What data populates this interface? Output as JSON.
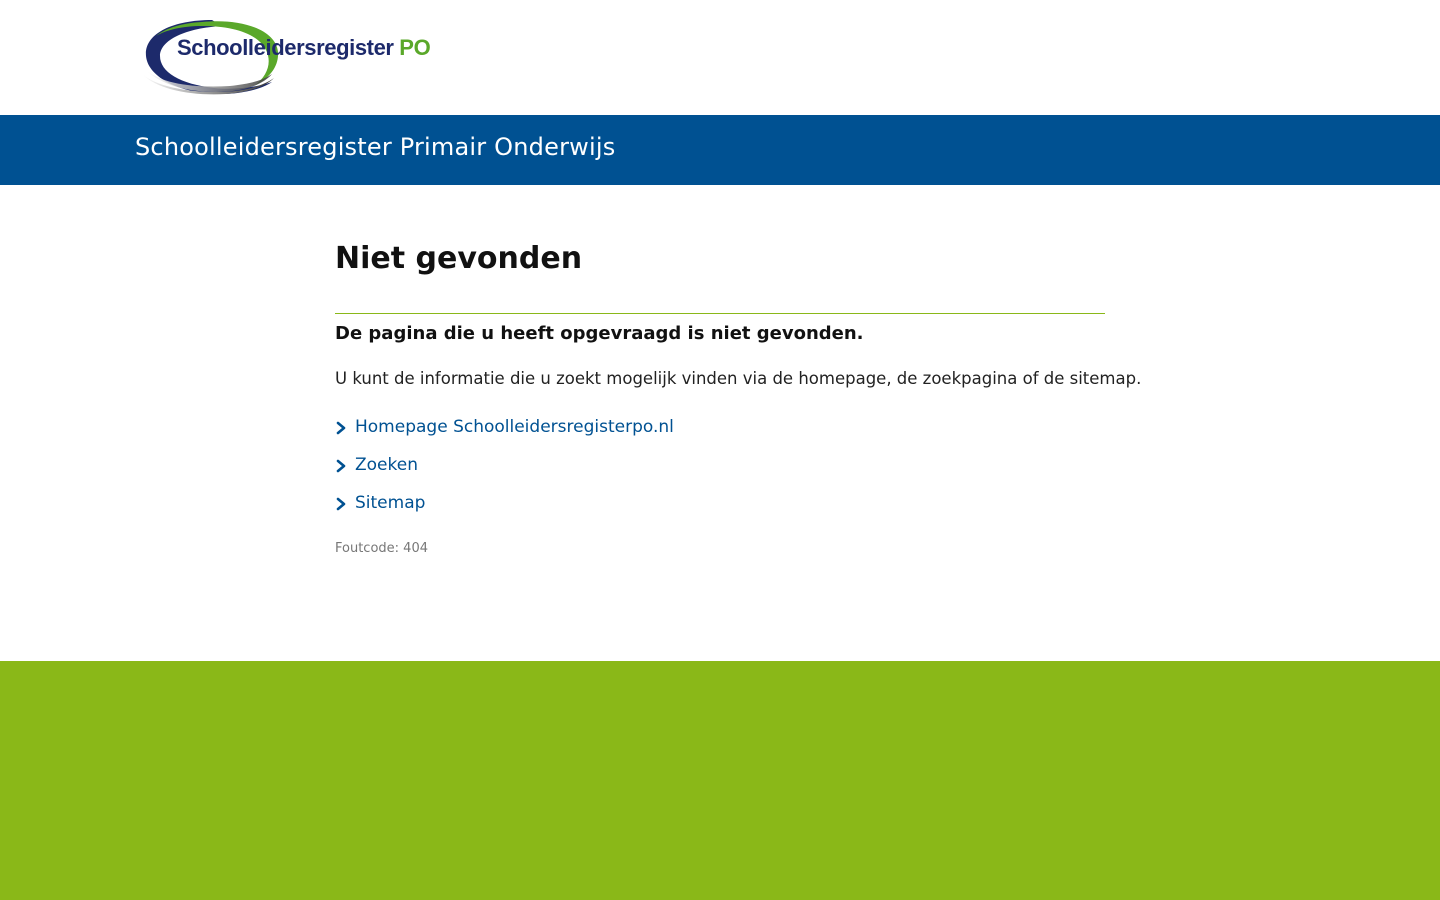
{
  "logo": {
    "text_main": "Schoolleidersregister",
    "text_suffix": "PO",
    "colors": {
      "navy": "#1d2a6b",
      "green": "#5aa82a"
    }
  },
  "banner": {
    "title": "Schoolleidersregister Primair Onderwijs",
    "background": "#005192"
  },
  "main": {
    "title": "Niet gevonden",
    "lead": "De pagina die u heeft opgevraagd is niet gevonden.",
    "body": "U kunt de informatie die u zoekt mogelijk vinden via de homepage, de zoekpagina of de sitemap.",
    "links": [
      {
        "label": "Homepage Schoolleidersregisterpo.nl",
        "icon": "chevron-right-icon"
      },
      {
        "label": "Zoeken",
        "icon": "chevron-right-icon"
      },
      {
        "label": "Sitemap",
        "icon": "chevron-right-icon"
      }
    ],
    "error_code": "Foutcode: 404"
  },
  "colors": {
    "link": "#005192",
    "divider": "#8ab818",
    "footer": "#8ab818"
  }
}
